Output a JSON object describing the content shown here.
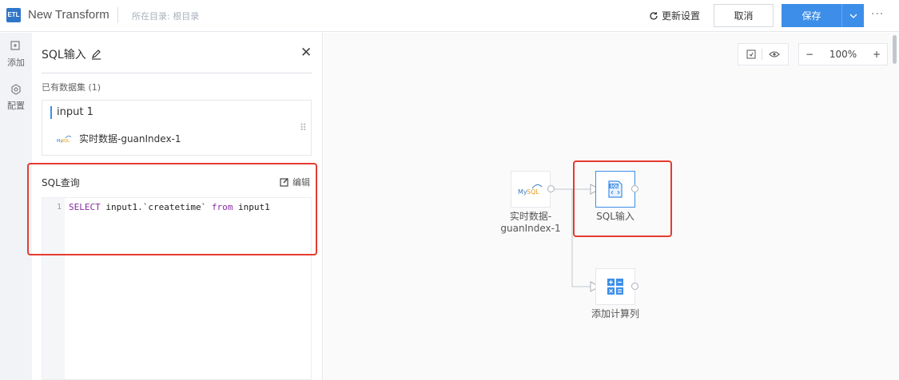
{
  "header": {
    "logo_text": "ETL",
    "title": "New Transform",
    "directory": "所在目录: 根目录",
    "refresh_setting": "更新设置",
    "cancel": "取消",
    "save": "保存",
    "more": "···"
  },
  "rail": {
    "add": "添加",
    "config": "配置"
  },
  "panel": {
    "title": "SQL输入",
    "datasets_label": "已有数据集 (1)",
    "dataset": {
      "name": "input 1",
      "source": "实时数据-guanIndex-1",
      "source_icon": "mysql-icon"
    },
    "sql_label": "SQL查询",
    "edit": "编辑",
    "code": {
      "line_number": "1",
      "keyword_select": "SELECT",
      "column_expr": " input1.`createtime` ",
      "keyword_from": "from",
      "table": " input1"
    }
  },
  "canvas": {
    "zoom": "100%",
    "zoom_minus": "−",
    "zoom_plus": "+",
    "nodes": [
      {
        "label_line1": "实时数据-",
        "label_line2": "guanIndex-1",
        "icon": "MySQL"
      },
      {
        "label": "SQL输入",
        "icon": "SQL"
      },
      {
        "label": "添加计算列",
        "icon": "calculator"
      }
    ]
  },
  "colors": {
    "primary": "#3d8ee8",
    "highlight": "#e53b30",
    "keyword": "#8a2aa3"
  }
}
